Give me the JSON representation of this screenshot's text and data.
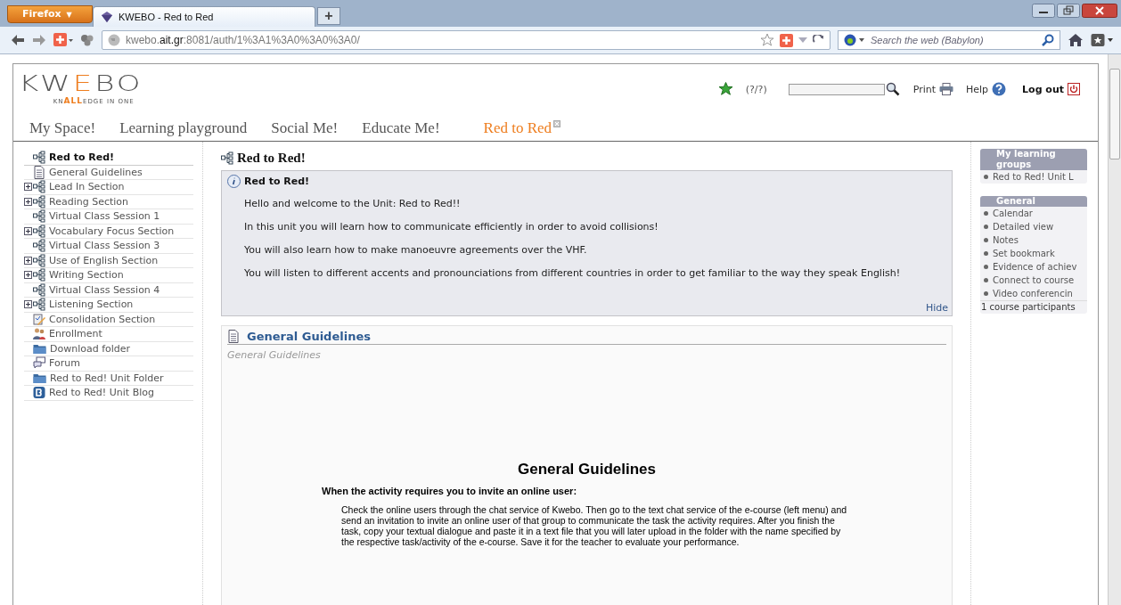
{
  "browser": {
    "menu_button": "Firefox",
    "menu_caret": "▼",
    "tabs": [
      {
        "title": "KWEBO - Red to Red",
        "selected": true
      }
    ],
    "new_tab": "+",
    "url": "kwebo.**ait.gr**:8081/auth/1%3A1%3A0%3A0%3A0/",
    "search": {
      "placeholder": "Search the web (Babylon)"
    }
  },
  "header": {
    "logo": {
      "lead": "KW",
      "accent": "E",
      "trail": "BO"
    },
    "tagline": "KN**ALL**EDGE IN ONE",
    "counter": "(?/?)",
    "links": [
      {
        "label": "Print",
        "kind": "print"
      },
      {
        "label": "Help",
        "kind": "help"
      },
      {
        "label": "Log out",
        "kind": "logout"
      }
    ]
  },
  "nav_tabs": [
    {
      "label": "My Space!",
      "selected": false,
      "closable": false
    },
    {
      "label": "Learning playground",
      "selected": false,
      "closable": false
    },
    {
      "label": "Social Me!",
      "selected": false,
      "closable": false
    },
    {
      "label": "Educate Me!",
      "selected": false,
      "closable": false
    },
    {
      "label": "Red to Red",
      "selected": true,
      "closable": true
    }
  ],
  "tree": [
    {
      "label": "Red to Red!",
      "kind": "section",
      "expandable": false,
      "selected": true
    },
    {
      "label": "General Guidelines",
      "kind": "document",
      "expandable": false,
      "selected": false
    },
    {
      "label": "Lead In Section",
      "kind": "section",
      "expandable": true,
      "selected": false
    },
    {
      "label": "Reading Section",
      "kind": "section",
      "expandable": true,
      "selected": false
    },
    {
      "label": "Virtual Class Session 1",
      "kind": "section",
      "expandable": false,
      "selected": false
    },
    {
      "label": "Vocabulary Focus Section",
      "kind": "section",
      "expandable": true,
      "selected": false
    },
    {
      "label": "Virtual Class Session 3",
      "kind": "section",
      "expandable": false,
      "selected": false
    },
    {
      "label": "Use of English Section",
      "kind": "section",
      "expandable": true,
      "selected": false
    },
    {
      "label": "Writing Section",
      "kind": "section",
      "expandable": true,
      "selected": false
    },
    {
      "label": "Virtual Class Session 4",
      "kind": "section",
      "expandable": false,
      "selected": false
    },
    {
      "label": "Listening Section",
      "kind": "section",
      "expandable": true,
      "selected": false
    },
    {
      "label": "Consolidation Section",
      "kind": "task",
      "expandable": false,
      "selected": false
    },
    {
      "label": "Enrollment",
      "kind": "people",
      "expandable": false,
      "selected": false
    },
    {
      "label": "Download folder",
      "kind": "folder",
      "expandable": false,
      "selected": false
    },
    {
      "label": "Forum",
      "kind": "forum",
      "expandable": false,
      "selected": false
    },
    {
      "label": "Red to Red! Unit Folder",
      "kind": "folder",
      "expandable": false,
      "selected": false
    },
    {
      "label": "Red to Red! Unit Blog",
      "kind": "blog",
      "expandable": false,
      "selected": false
    }
  ],
  "content": {
    "title": "Red to Red!",
    "info": {
      "title": "Red to Red!",
      "paragraphs": [
        "Hello and welcome to the Unit: Red to Red!!",
        "In this unit you will learn how to communicate efficiently in order to avoid collisions!",
        "You will also learn how to make manoeuvre agreements over the VHF.",
        "You will listen to different accents and pronounciations from different countries in order to get familiar to the way they speak English!"
      ],
      "hide": "Hide"
    },
    "panel": {
      "title": "General Guidelines",
      "subtitle": "General Guidelines",
      "document": {
        "heading": "General Guidelines",
        "subheading": "When the activity requires you to invite an online user:",
        "body": "Check the online users through the chat service of Kwebo. Then go to the text chat service of the e-course (left menu) and send an invitation to invite an online user of that group to communicate the task the activity requires. After you finish the task, copy your textual dialogue and paste it in a text file that you will later upload in the folder with the name specified by the respective task/activity of the e-course. Save it for the teacher to evaluate your performance."
      }
    }
  },
  "sidebar": [
    {
      "title": "My learning groups",
      "items": [
        "Red to Red! Unit L"
      ]
    },
    {
      "title": "General",
      "items": [
        "Calendar",
        "Detailed view",
        "Notes",
        "Set bookmark",
        "Evidence of achiev",
        "Connect to course",
        "Video conferencin"
      ],
      "footer": "1 course participants"
    }
  ]
}
